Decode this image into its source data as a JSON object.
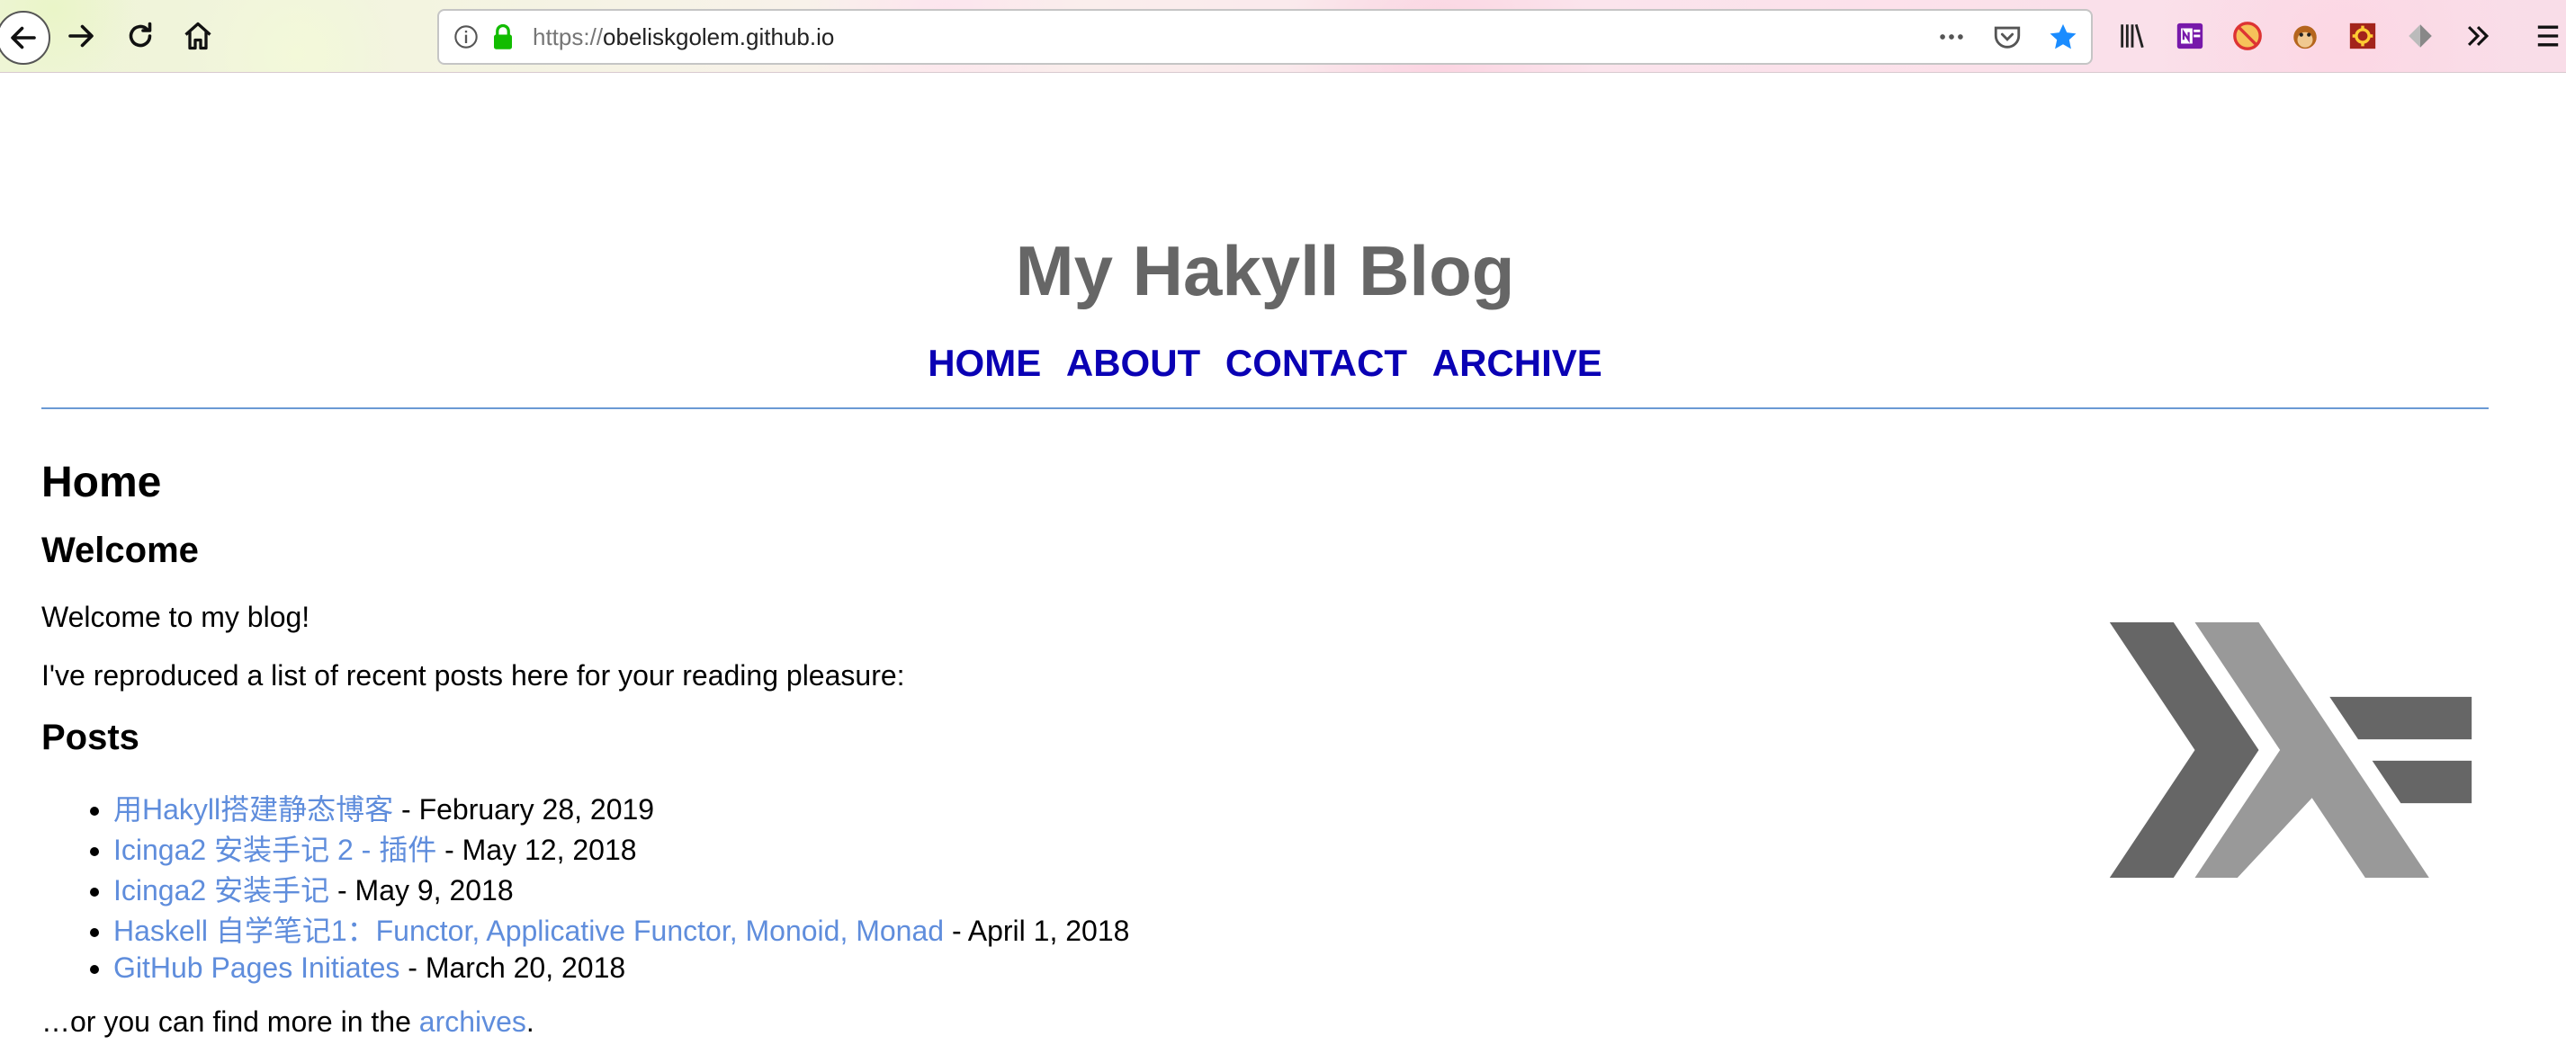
{
  "browser": {
    "url_protocol": "https://",
    "url_host": "obeliskgolem.github.io",
    "accent_color": "#1a8cff"
  },
  "site": {
    "title": "My Hakyll Blog",
    "nav": [
      "HOME",
      "ABOUT",
      "CONTACT",
      "ARCHIVE"
    ]
  },
  "page": {
    "heading": "Home",
    "welcome_heading": "Welcome",
    "welcome_text": "Welcome to my blog!",
    "intro_text": "I've reproduced a list of recent posts here for your reading pleasure:",
    "posts_heading": "Posts",
    "posts": [
      {
        "title": "用Hakyll搭建静态博客",
        "date": " - February 28, 2019"
      },
      {
        "title": "Icinga2 安装手记 2 - 插件",
        "date": " - May 12, 2018"
      },
      {
        "title": "Icinga2 安装手记",
        "date": " - May 9, 2018"
      },
      {
        "title": "Haskell 自学笔记1：Functor, Applicative Functor, Monoid, Monad",
        "date": " - April 1, 2018"
      },
      {
        "title": "GitHub Pages Initiates",
        "date": " - March 20, 2018"
      }
    ],
    "archives_prefix": "…or you can find more in the ",
    "archives_link": "archives",
    "archives_suffix": "."
  },
  "colors": {
    "title": "#666666",
    "nav_link": "#0a00b4",
    "post_link": "#5f8ddc",
    "rule": "#6a9ad4",
    "logo_dark": "#666666",
    "logo_light": "#999999"
  },
  "icons": [
    "back-arrow-icon",
    "forward-arrow-icon",
    "reload-icon",
    "home-icon",
    "info-icon",
    "lock-icon",
    "more-icon",
    "pocket-icon",
    "star-icon",
    "library-icon",
    "onenote-icon",
    "noscript-icon",
    "tampermonkey-icon",
    "gear-extension-icon",
    "diamond-extension-icon",
    "overflow-chevron-icon",
    "hamburger-menu-icon",
    "haskell-logo"
  ]
}
